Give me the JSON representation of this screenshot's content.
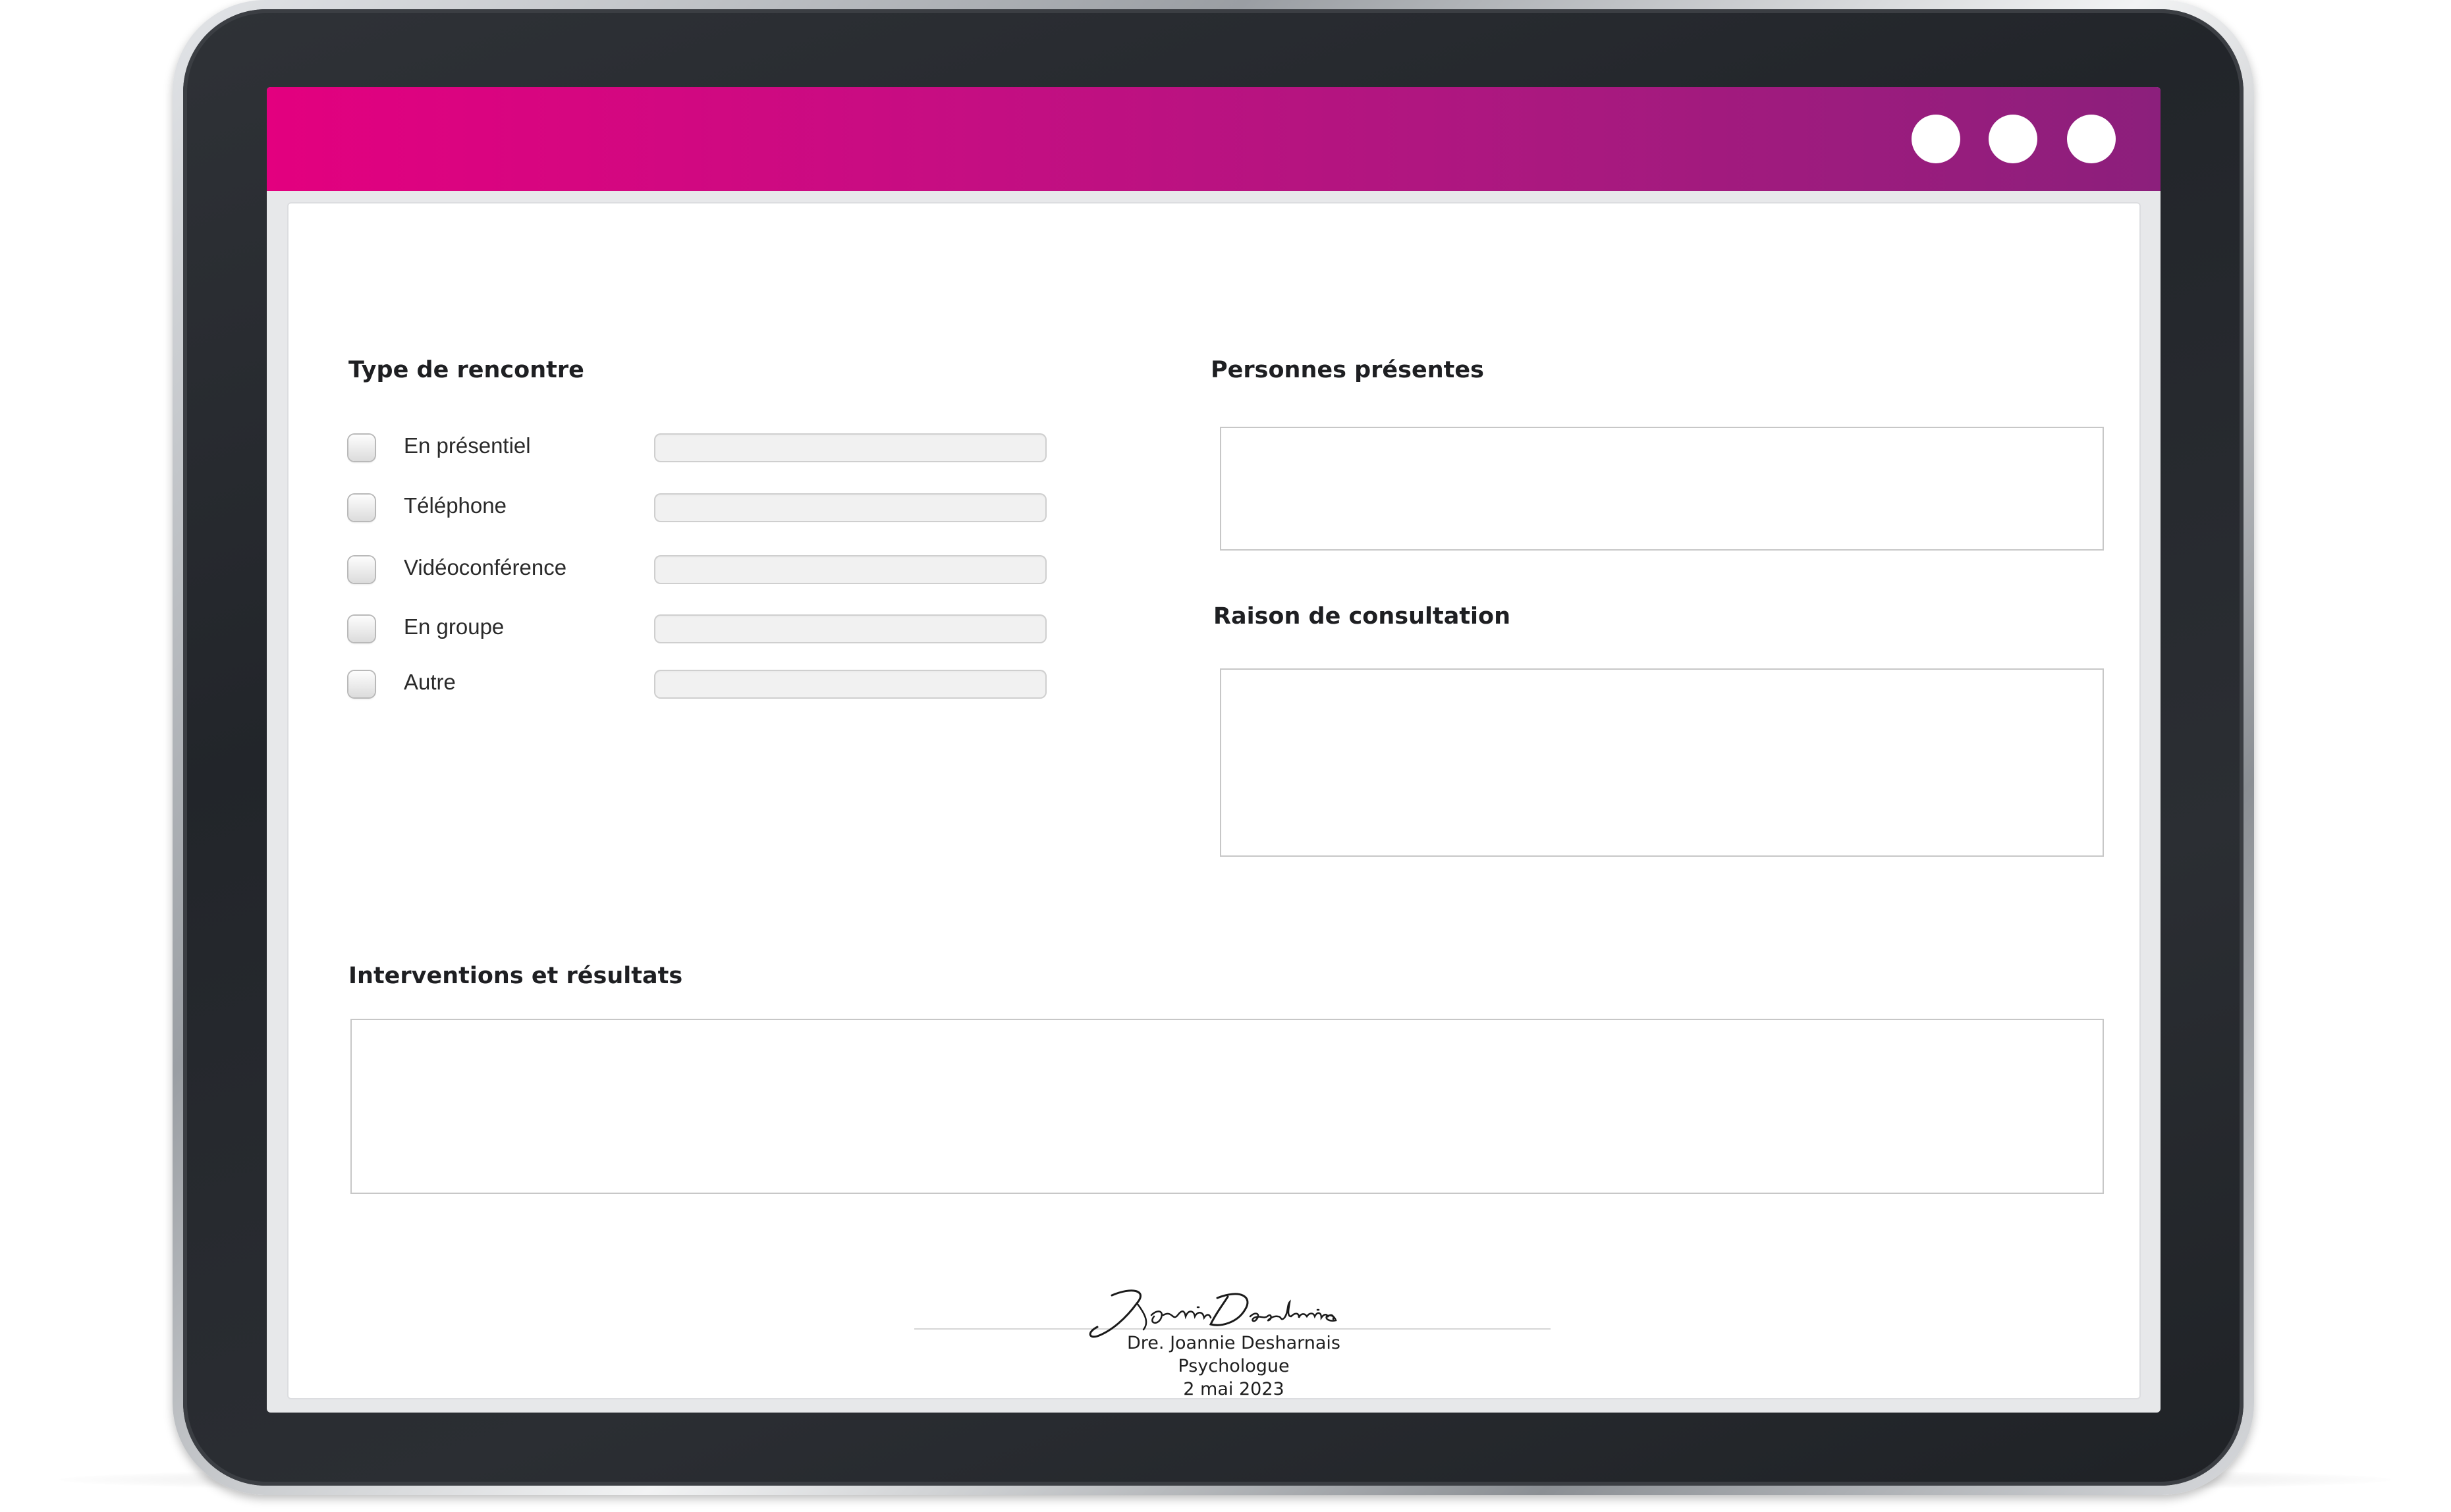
{
  "window": {
    "controls": [
      "circle-button",
      "circle-button",
      "circle-button"
    ],
    "accent_start": "#e3007f",
    "accent_end": "#8c1f7c"
  },
  "form": {
    "type_section": {
      "title": "Type de rencontre",
      "options": [
        {
          "label": "En présentiel",
          "checked": false,
          "value": ""
        },
        {
          "label": "Téléphone",
          "checked": false,
          "value": ""
        },
        {
          "label": "Vidéoconférence",
          "checked": false,
          "value": ""
        },
        {
          "label": "En groupe",
          "checked": false,
          "value": ""
        },
        {
          "label": "Autre",
          "checked": false,
          "value": ""
        }
      ]
    },
    "present_section": {
      "title": "Personnes présentes",
      "value": ""
    },
    "reason_section": {
      "title": "Raison de consultation",
      "value": ""
    },
    "interventions_section": {
      "title": "Interventions et résultats",
      "value": ""
    }
  },
  "signature": {
    "script_name": "Joannie Desharnais",
    "name": "Dre. Joannie Desharnais",
    "role": "Psychologue",
    "date": "2 mai 2023"
  }
}
